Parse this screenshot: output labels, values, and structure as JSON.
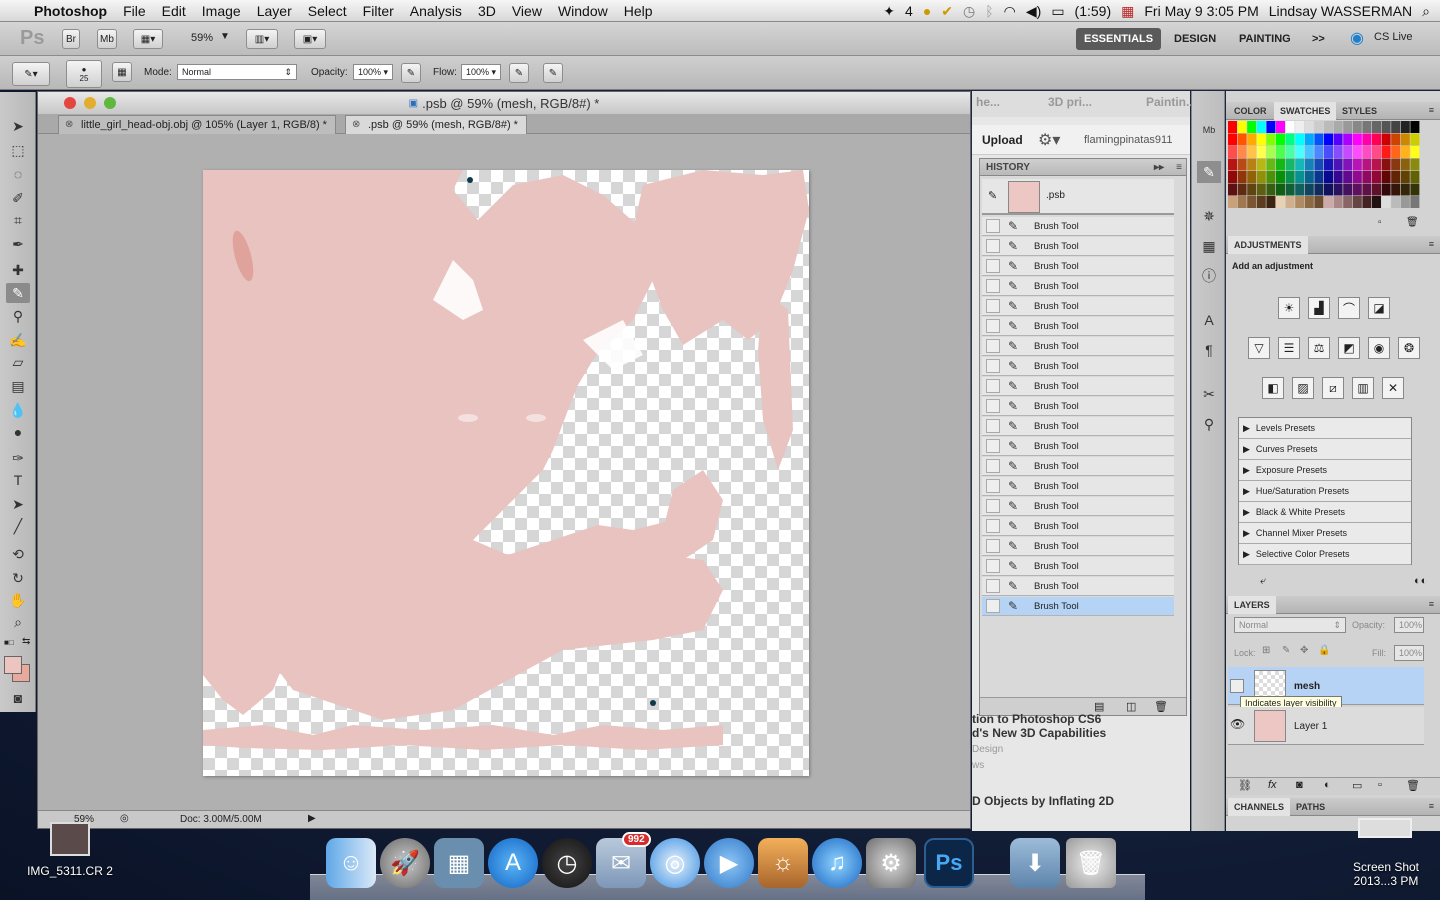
{
  "menubar": {
    "app": "Photoshop",
    "items": [
      "File",
      "Edit",
      "Image",
      "Layer",
      "Select",
      "Filter",
      "Analysis",
      "3D",
      "View",
      "Window",
      "Help"
    ],
    "status_num": "4",
    "battery": "(1:59)",
    "datetime": "Fri May 9  3:05 PM",
    "user": "Lindsay WASSERMAN"
  },
  "appbar": {
    "ps_logo": "Ps",
    "br": "Br",
    "mb": "Mb",
    "zoom": "59%",
    "workspaces": [
      "ESSENTIALS",
      "DESIGN",
      "PAINTING"
    ],
    "more": ">>",
    "cslive": "CS Live"
  },
  "options": {
    "brush_size": "25",
    "mode_label": "Mode:",
    "mode_value": "Normal",
    "opacity_label": "Opacity:",
    "opacity_value": "100%",
    "flow_label": "Flow:",
    "flow_value": "100%"
  },
  "document": {
    "title": ".psb @ 59% (mesh, RGB/8#) *",
    "tabs": [
      {
        "label": "little_girl_head-obj.obj @ 105% (Layer 1, RGB/8) *"
      },
      {
        "label": ".psb @ 59% (mesh, RGB/8#) *"
      }
    ],
    "status_zoom": "59%",
    "status_doc": "Doc: 3.00M/5.00M"
  },
  "middle": {
    "tabs": [
      "he...",
      "3D pri...",
      "Paintin..."
    ],
    "upload": "Upload",
    "username": "flamingpinatas911",
    "web_lines": [
      "tion to Photoshop CS6",
      "d's New 3D Capabilities",
      "Design",
      "ws",
      "D Objects by Inflating 2D"
    ]
  },
  "history": {
    "header": "HISTORY",
    "snapshot": ".psb",
    "item_label": "Brush Tool",
    "count": 20
  },
  "color_panel": {
    "tabs": [
      "COLOR",
      "SWATCHES",
      "STYLES"
    ]
  },
  "adjustments": {
    "header": "ADJUSTMENTS",
    "subtitle": "Add an adjustment",
    "presets": [
      "Levels Presets",
      "Curves Presets",
      "Exposure Presets",
      "Hue/Saturation Presets",
      "Black & White Presets",
      "Channel Mixer Presets",
      "Selective Color Presets"
    ]
  },
  "layers": {
    "header": "LAYERS",
    "blend": "Normal",
    "opacity_label": "Opacity:",
    "opacity": "100%",
    "lock_label": "Lock:",
    "fill_label": "Fill:",
    "fill": "100%",
    "items": [
      {
        "name": "mesh"
      },
      {
        "name": "Layer 1"
      }
    ],
    "tooltip": "Indicates layer visibility"
  },
  "channels": {
    "tabs": [
      "CHANNELS",
      "PATHS"
    ]
  },
  "dock": {
    "badge": "992"
  },
  "desktop": {
    "file1": "IMG_5311.CR 2",
    "file2": "Screen Shot 2013...3 PM"
  },
  "colors": {
    "paint": "#e8c3c0",
    "accent": "#b4d3f5"
  }
}
